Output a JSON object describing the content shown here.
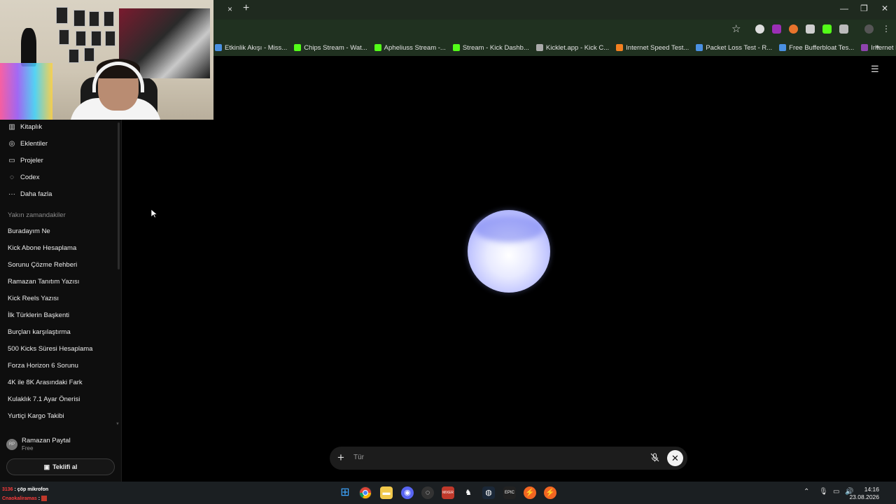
{
  "browser": {
    "tab_close": "×",
    "tab_new": "+",
    "bookmarks": [
      {
        "label": "Etkinlik Akışı - Miss...",
        "icon": "globe-icon",
        "color": "#4a90e2"
      },
      {
        "label": "Chips Stream - Wat...",
        "icon": "kick-icon",
        "color": "#53fc18"
      },
      {
        "label": "Apheliuss Stream -...",
        "icon": "kick-icon",
        "color": "#53fc18"
      },
      {
        "label": "Stream - Kick Dashb...",
        "icon": "kick-icon",
        "color": "#53fc18"
      },
      {
        "label": "Kicklet.app - Kick C...",
        "icon": "kicklet-icon",
        "color": "#aaaaaa"
      },
      {
        "label": "Internet Speed Test...",
        "icon": "cloudflare-icon",
        "color": "#f38020"
      },
      {
        "label": "Packet Loss Test - R...",
        "icon": "wave-icon",
        "color": "#4a90e2"
      },
      {
        "label": "Free Bufferbloat Tes...",
        "icon": "bolt-icon",
        "color": "#4a90e2"
      },
      {
        "label": "Internet Hız Testi &...",
        "icon": "speedtest-icon",
        "color": "#8e44ad"
      }
    ],
    "bookmarks_more": "»"
  },
  "sidebar": {
    "nav": [
      {
        "label": "Kitaplık",
        "icon": "library-icon",
        "glyph": "▥"
      },
      {
        "label": "Eklentiler",
        "icon": "apps-icon",
        "glyph": "◎"
      },
      {
        "label": "Projeler",
        "icon": "folder-icon",
        "glyph": "▭"
      },
      {
        "label": "Codex",
        "icon": "codex-icon",
        "glyph": "◌"
      },
      {
        "label": "Daha fazla",
        "icon": "more-icon",
        "glyph": "···"
      }
    ],
    "recent_label": "Yakın zamandakiler",
    "recent": [
      "Buradayım Ne",
      "Kick Abone Hesaplama",
      "Sorunu Çözme Rehberi",
      "Ramazan Tanıtım Yazısı",
      "Kick Reels Yazısı",
      "İlk Türklerin Başkenti",
      "Burçları karşılaştırma",
      "500 Kicks Süresi Hesaplama",
      "Forza Horizon 6 Sorunu",
      "4K ile 8K Arasındaki Fark",
      "Kulaklık 7.1 Ayar Önerisi",
      "Yurtiçi Kargo Takibi"
    ],
    "user": {
      "initials": "RP",
      "name": "Ramazan Paytal",
      "plan": "Free"
    },
    "upgrade_label": "Teklifi al"
  },
  "composer": {
    "plus": "+",
    "placeholder": "Tür",
    "end_glyph": "✕"
  },
  "overlay_chat": [
    {
      "user": "3136",
      "text": ": çöp mikrofon",
      "color": "#ff3b3b"
    },
    {
      "user": "Cnaokaliramas",
      "text": ":",
      "color": "#ff3b3b"
    }
  ],
  "clock": {
    "time": "14:16",
    "date": "23.08.2026"
  }
}
